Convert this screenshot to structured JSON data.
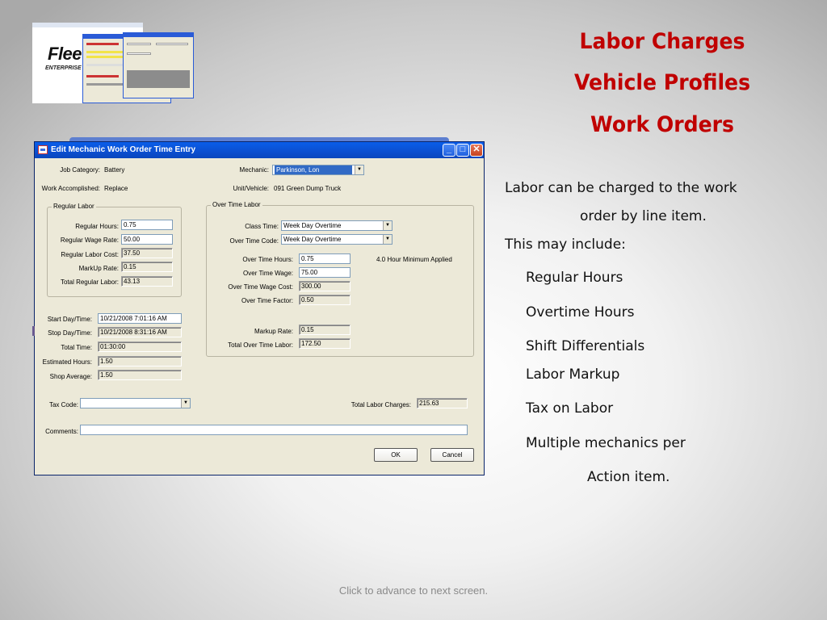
{
  "thumbnail": {
    "logo_text": "Flee",
    "logo_sub": "ENTERPRISE E"
  },
  "headings": [
    "Labor Charges",
    "Vehicle Profiles",
    "Work Orders"
  ],
  "body": {
    "line1": "Labor can be charged to the work",
    "line2": "order by line item.",
    "line3": "This may include:",
    "items": [
      "Regular Hours",
      "Overtime Hours",
      "Shift Differentials",
      "Labor Markup",
      "Tax on Labor",
      "Multiple mechanics  per"
    ],
    "last": "Action item."
  },
  "footer": "Click to advance to next screen.",
  "dialog": {
    "title": "Edit Mechanic Work Order Time Entry",
    "job_category": {
      "label": "Job Category:",
      "value": "Battery"
    },
    "work_accomplished": {
      "label": "Work Accomplished:",
      "value": "Replace"
    },
    "mechanic": {
      "label": "Mechanic:",
      "value": "Parkinson, Lon"
    },
    "unit_vehicle": {
      "label": "Unit/Vehicle:",
      "value": "091 Green Dump Truck"
    },
    "regular": {
      "group_label": "Regular Labor",
      "hours": {
        "label": "Regular Hours:",
        "value": "0.75"
      },
      "wage": {
        "label": "Regular Wage Rate:",
        "value": "50.00"
      },
      "cost": {
        "label": "Regular Labor Cost:",
        "value": "37.50"
      },
      "markup": {
        "label": "MarkUp Rate:",
        "value": "0.15"
      },
      "total": {
        "label": "Total Regular Labor:",
        "value": "43.13"
      }
    },
    "overtime": {
      "group_label": "Over Time Labor",
      "class_time": {
        "label": "Class Time:",
        "value": "Week Day Overtime"
      },
      "code": {
        "label": "Over Time Code:",
        "value": "Week Day Overtime"
      },
      "hours": {
        "label": "Over Time  Hours:",
        "value": "0.75"
      },
      "note": "4.0 Hour Minimum Applied",
      "wage": {
        "label": "Over Time Wage:",
        "value": "75.00"
      },
      "wage_cost": {
        "label": "Over Time Wage Cost:",
        "value": "300.00"
      },
      "factor": {
        "label": "Over Time Factor:",
        "value": "0.50"
      },
      "markup": {
        "label": "Markup Rate:",
        "value": "0.15"
      },
      "total": {
        "label": "Total Over Time  Labor:",
        "value": "172.50"
      }
    },
    "times": {
      "start": {
        "label": "Start Day/Time:",
        "value": "10/21/2008 7:01:16 AM"
      },
      "stop": {
        "label": "Stop Day/Time:",
        "value": "10/21/2008 8:31:16 AM"
      },
      "total": {
        "label": "Total Time:",
        "value": "01:30:00"
      },
      "estimated": {
        "label": "Estimated Hours:",
        "value": "1.50"
      },
      "shop_avg": {
        "label": "Shop Average:",
        "value": "1.50"
      }
    },
    "tax_code": {
      "label": "Tax Code:",
      "value": ""
    },
    "total_labor": {
      "label": "Total Labor Charges:",
      "value": "215.63"
    },
    "comments": {
      "label": "Comments:",
      "value": ""
    },
    "ok_label": "OK",
    "cancel_label": "Cancel",
    "min_symbol": "_",
    "max_symbol": "□",
    "close_symbol": "✕",
    "arrow_symbol": "▼"
  }
}
